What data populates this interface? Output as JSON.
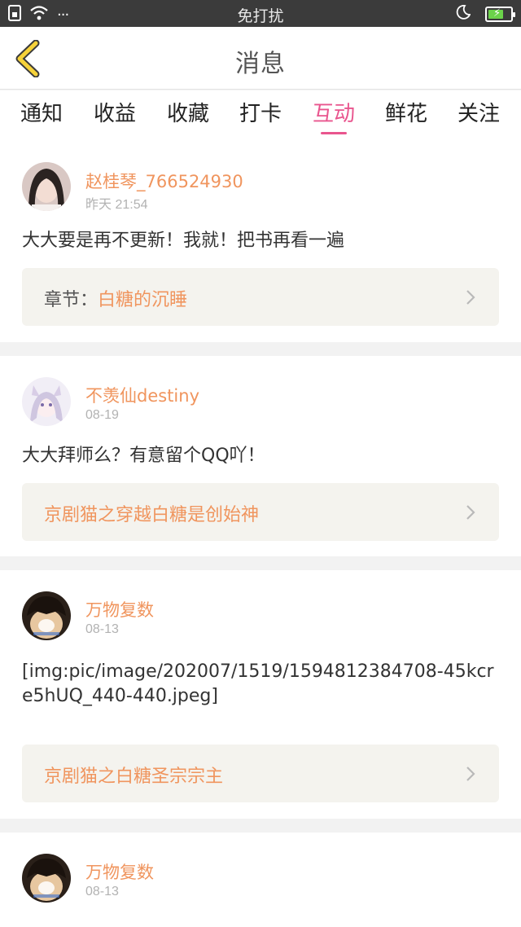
{
  "status_bar": {
    "center_text": "免打扰",
    "more_dots": "···",
    "icons": [
      "sim-icon",
      "wifi-icon",
      "moon-icon",
      "battery-icon"
    ],
    "battery_level": 0.7
  },
  "header": {
    "title": "消息",
    "back_icon": "back-chevron-icon"
  },
  "tabs": [
    {
      "label": "通知"
    },
    {
      "label": "收益"
    },
    {
      "label": "收藏"
    },
    {
      "label": "打卡"
    },
    {
      "label": "互动",
      "active": true
    },
    {
      "label": "鲜花"
    },
    {
      "label": "关注"
    }
  ],
  "messages": [
    {
      "user": "赵桂琴_766524930",
      "date": "昨天 21:54",
      "text": "大大要是再不更新！我就！把书再看一遍",
      "ref_prefix": "章节：",
      "ref_title": "白糖的沉睡"
    },
    {
      "user": "不羡仙destiny",
      "date": "08-19",
      "text": "大大拜师么？有意留个QQ吖！",
      "ref_prefix": "",
      "ref_title": "京剧猫之穿越白糖是创始神"
    },
    {
      "user": "万物复数",
      "date": "08-13",
      "text": "[img:pic/image/202007/1519/1594812384708-45kcre5hUQ_440-440.jpeg]",
      "ref_prefix": "",
      "ref_title": "京剧猫之白糖圣宗宗主"
    },
    {
      "user": "万物复数",
      "date": "08-13",
      "text": "",
      "ref_prefix": "",
      "ref_title": ""
    }
  ],
  "colors": {
    "accent_pink": "#e9558e",
    "username_orange": "#f0955e",
    "ref_background": "#f4f3ee",
    "back_arrow_yellow": "#f6d23a"
  }
}
